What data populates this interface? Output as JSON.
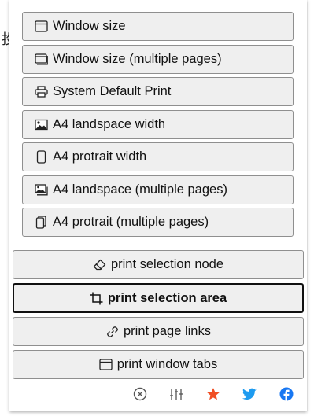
{
  "background": {
    "partial_text": "投"
  },
  "menu": {
    "items": [
      {
        "label": "Window size",
        "icon": "window-icon"
      },
      {
        "label": "Window size (multiple pages)",
        "icon": "windows-stack-icon"
      },
      {
        "label": "System Default Print",
        "icon": "printer-icon"
      },
      {
        "label": "A4 landspace width",
        "icon": "image-icon"
      },
      {
        "label": "A4 protrait width",
        "icon": "portrait-page-icon"
      },
      {
        "label": "A4 landspace (multiple pages)",
        "icon": "images-stack-icon"
      },
      {
        "label": "A4 protrait (multiple pages)",
        "icon": "pages-stack-icon"
      }
    ]
  },
  "actions": [
    {
      "label": "print selection node",
      "icon": "eraser-icon",
      "active": false
    },
    {
      "label": "print selection area",
      "icon": "crop-icon",
      "active": true
    },
    {
      "label": "print page links",
      "icon": "link-icon",
      "active": false
    },
    {
      "label": "print window tabs",
      "icon": "window-icon",
      "active": false
    }
  ],
  "footer": {
    "icons": [
      "close-circle-icon",
      "sliders-icon",
      "star-icon",
      "twitter-icon",
      "facebook-icon"
    ],
    "colors": {
      "star": "#f04e23",
      "twitter": "#1d9bf0",
      "facebook": "#1877f2",
      "gray": "#555555"
    }
  }
}
